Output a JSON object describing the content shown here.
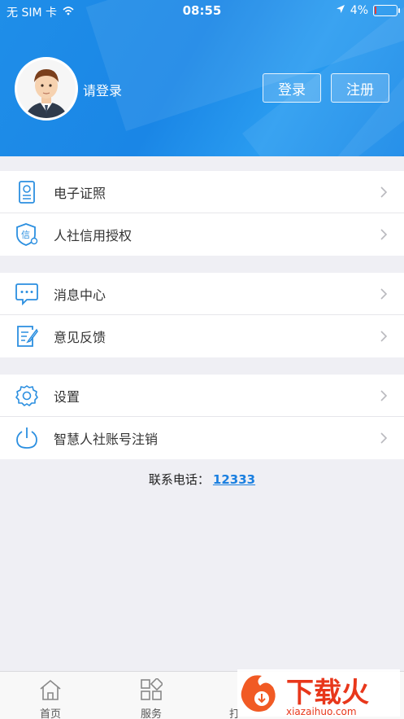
{
  "status_bar": {
    "carrier": "无 SIM 卡",
    "time": "08:55",
    "battery": "4%",
    "battery_level": 0.04,
    "icons": [
      "wifi-icon",
      "location-arrow-icon",
      "battery-icon"
    ]
  },
  "header": {
    "login_prompt": "请登录",
    "login_button": "登录",
    "register_button": "注册"
  },
  "menu_groups": [
    [
      {
        "label": "电子证照",
        "icon": "certificate-icon"
      },
      {
        "label": "人社信用授权",
        "icon": "credit-shield-icon"
      }
    ],
    [
      {
        "label": "消息中心",
        "icon": "message-icon"
      },
      {
        "label": "意见反馈",
        "icon": "feedback-icon"
      }
    ],
    [
      {
        "label": "设置",
        "icon": "gear-icon"
      },
      {
        "label": "智慧人社账号注销",
        "icon": "power-icon"
      }
    ]
  ],
  "contact": {
    "label": "联系电话：",
    "phone": "12333"
  },
  "tabbar": {
    "tabs": [
      {
        "label": "首页",
        "icon": "home-icon"
      },
      {
        "label": "服务",
        "icon": "grid-icon"
      },
      {
        "label": "打",
        "icon": "tab-icon"
      }
    ]
  },
  "watermark": {
    "text_cn": "下载火",
    "text_en": "xiazaihuo.com"
  },
  "colors": {
    "primary": "#1a86e6",
    "icon_blue": "#2b8fe0",
    "link": "#1a7fe0",
    "background": "#efeff4"
  }
}
